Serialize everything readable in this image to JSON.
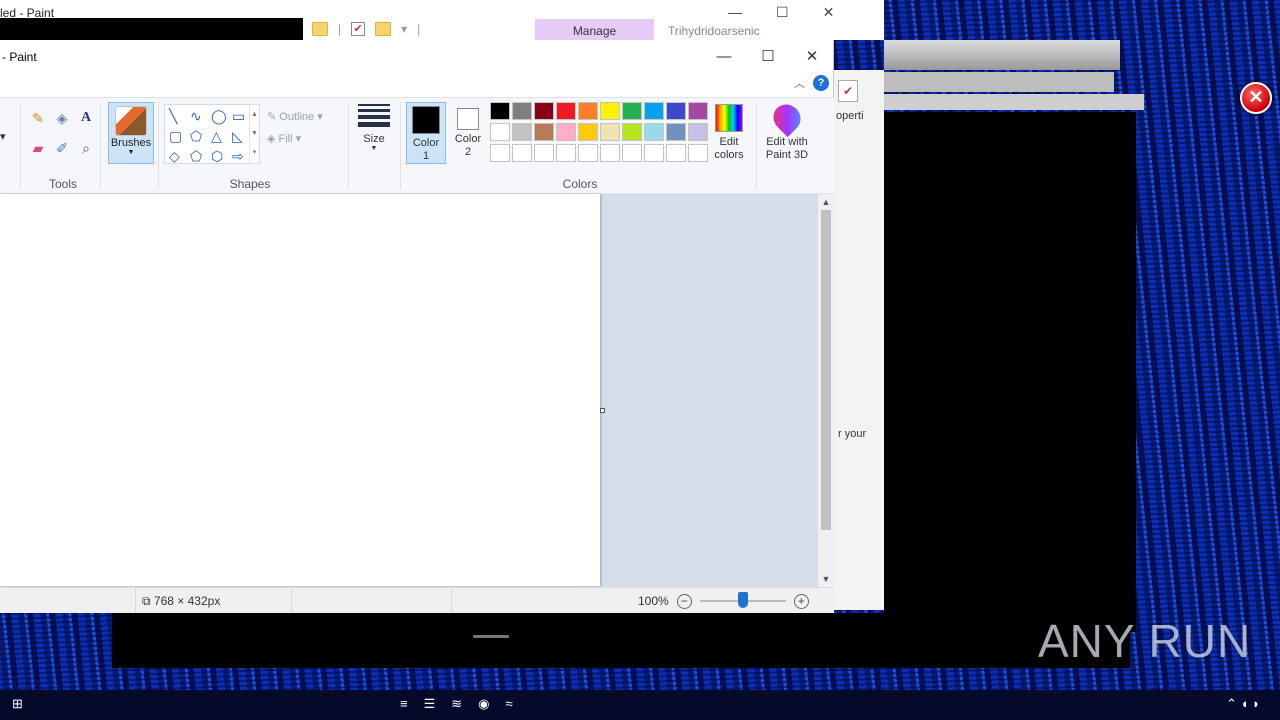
{
  "background_window": {
    "title_fragment": "led - Paint",
    "manage_tab": "Manage",
    "context_tab": "Trihydridoarsenic",
    "right_fragment_1": "operti",
    "right_fragment_2": "r your"
  },
  "paint": {
    "title": "- Paint",
    "window_buttons": {
      "minimize": "—",
      "maximize": "☐",
      "close": "✕"
    },
    "help": "?",
    "groups": {
      "tools": "Tools",
      "shapes": "Shapes",
      "colors": "Colors"
    },
    "brushes_label": "Brushes",
    "outline_label": "Outline",
    "fill_label": "Fill",
    "size_label": "Size",
    "color1": {
      "line1": "Color",
      "line2": "1",
      "value": "#000000"
    },
    "color2": {
      "line1": "Color",
      "line2": "2",
      "value": "#ffffff"
    },
    "edit_colors": {
      "line1": "Edit",
      "line2": "colors"
    },
    "edit_3d": {
      "line1": "Edit with",
      "line2": "Paint 3D"
    },
    "palette": [
      "#000000",
      "#7f7f7f",
      "#880015",
      "#ed1c24",
      "#ff7f27",
      "#fff200",
      "#22b14c",
      "#00a2e8",
      "#3f48cc",
      "#a349a4",
      "#ffffff",
      "#c3c3c3",
      "#b97a57",
      "#ffaec9",
      "#ffc90e",
      "#efe4b0",
      "#b5e61d",
      "#99d9ea",
      "#7092be",
      "#c8bfe7",
      "#ffffff",
      "#ffffff",
      "#ffffff",
      "#ffffff",
      "#ffffff",
      "#ffffff",
      "#ffffff",
      "#ffffff",
      "#ffffff",
      "#ffffff"
    ],
    "status": {
      "dimensions": "768 × 432px",
      "zoom": "100%",
      "zoom_level": 0.5
    }
  },
  "watermark": "ANY RUN"
}
